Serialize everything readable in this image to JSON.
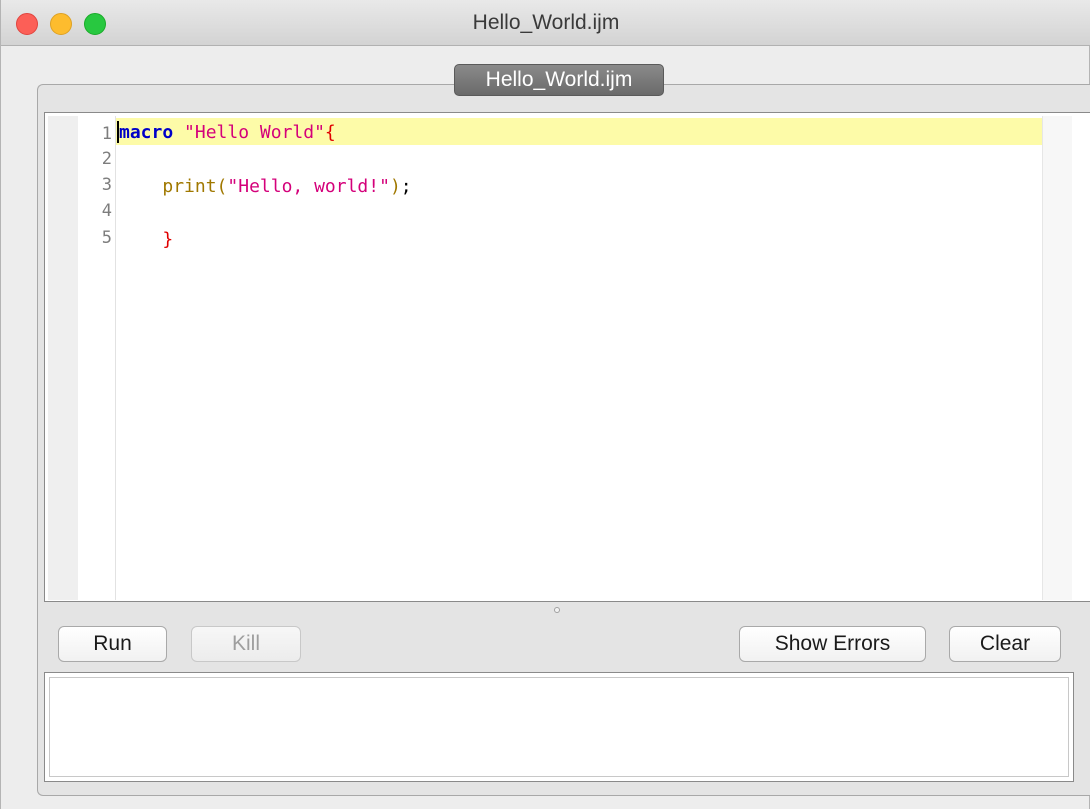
{
  "window": {
    "title": "Hello_World.ijm",
    "controls": {
      "close": "close-button",
      "minimize": "minimize-button",
      "zoom": "zoom-button"
    }
  },
  "tabs": [
    {
      "label": "Hello_World.ijm",
      "active": true
    }
  ],
  "editor": {
    "line_numbers": [
      "1",
      "2",
      "3",
      "4",
      "5"
    ],
    "current_line": 1,
    "highlight_color": "#fdfba8",
    "lines": [
      [
        {
          "text": "macro",
          "kind": "keyword"
        },
        {
          "text": " ",
          "kind": "plain"
        },
        {
          "text": "\"Hello World\"",
          "kind": "string"
        },
        {
          "text": "{",
          "kind": "brace"
        }
      ],
      [],
      [
        {
          "text": "    ",
          "kind": "plain"
        },
        {
          "text": "print(",
          "kind": "func"
        },
        {
          "text": "\"Hello, world!\"",
          "kind": "string"
        },
        {
          "text": ")",
          "kind": "func"
        },
        {
          "text": ";",
          "kind": "plain"
        }
      ],
      [],
      [
        {
          "text": "    ",
          "kind": "plain"
        },
        {
          "text": "}",
          "kind": "brace"
        }
      ]
    ]
  },
  "toolbar": {
    "run_label": "Run",
    "kill_label": "Kill",
    "kill_enabled": false,
    "show_errors_label": "Show Errors",
    "clear_label": "Clear"
  },
  "output": {
    "text": ""
  },
  "colors": {
    "keyword": "#0000c8",
    "string": "#d4007a",
    "function": "#a07800",
    "brace": "#e00000"
  }
}
